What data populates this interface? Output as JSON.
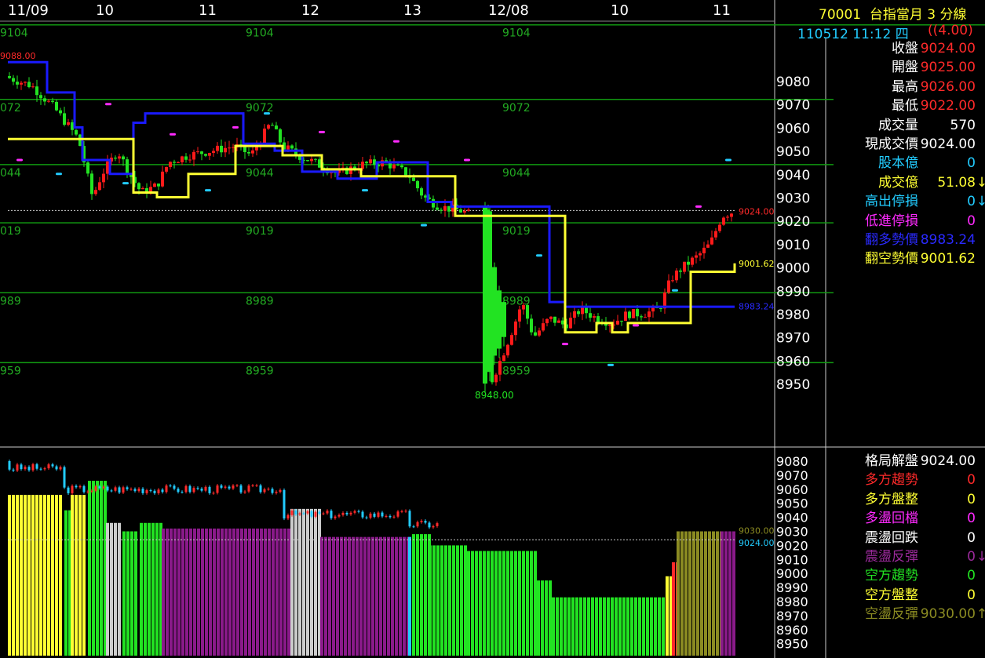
{
  "header": {
    "symbol": "70001",
    "title": "台指當月 3 分線",
    "datetime": "110512 11:12 四",
    "change": "((4.00)"
  },
  "colors": {
    "up": "#ff1a1a",
    "down": "#22e322",
    "break_line": "#ffff33",
    "trend_line": "#1a1aff",
    "grid": "#119911",
    "axis_text": "#ffffff"
  },
  "main_chart": {
    "time_labels": [
      "11/09",
      "10",
      "11",
      "12",
      "13",
      "12/08",
      "10",
      "11"
    ],
    "y_ticks": [
      9080,
      9070,
      9060,
      9050,
      9040,
      9030,
      9020,
      9010,
      9000,
      8990,
      8980,
      8970,
      8960,
      8950
    ],
    "green_levels": [
      {
        "value": 9104,
        "labels": [
          "9104",
          "9104",
          "9104"
        ]
      },
      {
        "value": 9072,
        "labels": [
          "072",
          "9072",
          "9072"
        ]
      },
      {
        "value": 9044,
        "labels": [
          "044",
          "9044",
          "9044"
        ]
      },
      {
        "value": 9019,
        "labels": [
          "019",
          "9019",
          "9019"
        ]
      },
      {
        "value": 8989,
        "labels": [
          "989",
          "8989",
          "8989"
        ]
      },
      {
        "value": 8959,
        "labels": [
          "959",
          "8959",
          "8959"
        ]
      }
    ],
    "annotations": {
      "high_marker": "9088.00",
      "low_marker": "8948.00",
      "last_price": "9024.00",
      "break_line_value": "9001.62",
      "trend_line_value": "8983.24"
    }
  },
  "chart_data": [
    {
      "type": "candlestick",
      "series": [
        {
          "name": "翻多勢價",
          "values": [
            9088,
            9075,
            9060,
            9046,
            9040,
            9040,
            9062,
            9066,
            9053,
            9050,
            9041,
            9038,
            9045,
            9045,
            9028,
            9026,
            9026,
            9026,
            8985,
            8983,
            8983,
            8983,
            8983,
            8983,
            8983,
            8983
          ]
        },
        {
          "name": "翻空勢價",
          "values": [
            9055,
            9055,
            9055,
            9055,
            9032,
            9030,
            9040,
            9052,
            9048,
            9042,
            9039,
            9039,
            9039,
            9039,
            9022,
            9022,
            9022,
            9022,
            8972,
            8972,
            8976,
            8972,
            8976,
            8976,
            8998,
            9001.62
          ]
        }
      ],
      "price_range": [
        8945,
        9112
      ],
      "last_close": 9024.0
    },
    {
      "type": "bar",
      "title": "",
      "series": [
        {
          "name": "state",
          "values": [
            9080,
            9060,
            9040,
            9020,
            9000,
            8980,
            8960
          ]
        }
      ]
    }
  ],
  "quote_panel": {
    "rows": [
      {
        "label": "收盤",
        "value": "9024.00",
        "label_color": "#ffffff",
        "value_color": "#ff2a2a"
      },
      {
        "label": "開盤",
        "value": "9025.00",
        "label_color": "#ffffff",
        "value_color": "#ff2a2a"
      },
      {
        "label": "最高",
        "value": "9026.00",
        "label_color": "#ffffff",
        "value_color": "#ff2a2a"
      },
      {
        "label": "最低",
        "value": "9022.00",
        "label_color": "#ffffff",
        "value_color": "#ff2a2a"
      },
      {
        "label": "成交量",
        "value": "570",
        "label_color": "#ffffff",
        "value_color": "#ffffff"
      },
      {
        "label": "現成交價",
        "value": "9024.00",
        "label_color": "#ffffff",
        "value_color": "#ffffff"
      },
      {
        "label": "股本億",
        "value": "0",
        "label_color": "#22ccff",
        "value_color": "#22ccff"
      },
      {
        "label": "成交億",
        "value": "51.08",
        "label_color": "#ffff33",
        "value_color": "#ffff33",
        "arrow": "↓",
        "arrow_color": "#ffff33"
      },
      {
        "label": "高出停損",
        "value": "0",
        "label_color": "#22ccff",
        "value_color": "#22ccff",
        "arrow": "↓",
        "arrow_color": "#22ccff"
      },
      {
        "label": "低進停損",
        "value": "0",
        "label_color": "#ff2aff",
        "value_color": "#ff2aff"
      },
      {
        "label": "翻多勢價",
        "value": "8983.24",
        "label_color": "#2a2aff",
        "value_color": "#2a2aff"
      },
      {
        "label": "翻空勢價",
        "value": "9001.62",
        "label_color": "#ffff33",
        "value_color": "#ffff33"
      }
    ]
  },
  "state_panel": {
    "rows": [
      {
        "label": "格局解盤",
        "value": "9024.00",
        "label_color": "#ffffff",
        "value_color": "#ffffff"
      },
      {
        "label": "多方趨勢",
        "value": "0",
        "label_color": "#ff2a2a",
        "value_color": "#ff2a2a"
      },
      {
        "label": "多方盤整",
        "value": "0",
        "label_color": "#ffff33",
        "value_color": "#ffff33"
      },
      {
        "label": "多盪回檔",
        "value": "0",
        "label_color": "#ff2aff",
        "value_color": "#ff2aff"
      },
      {
        "label": "震盪回跌",
        "value": "0",
        "label_color": "#ffffff",
        "value_color": "#ffffff"
      },
      {
        "label": "震盪反彈",
        "value": "0",
        "label_color": "#9a2a9a",
        "value_color": "#9a2a9a",
        "arrow": "↓",
        "arrow_color": "#9a2a9a"
      },
      {
        "label": "空方趨勢",
        "value": "0",
        "label_color": "#22e322",
        "value_color": "#22e322"
      },
      {
        "label": "空方盤整",
        "value": "0",
        "label_color": "#ffff33",
        "value_color": "#ffff33"
      },
      {
        "label": "空盪反彈",
        "value": "9030.00",
        "label_color": "#8b8b22",
        "value_color": "#8b8b22",
        "arrow": "↑",
        "arrow_color": "#8b8b22"
      }
    ]
  },
  "sub_chart": {
    "y_ticks": [
      9080,
      9070,
      9060,
      9050,
      9040,
      9030,
      9020,
      9010,
      9000,
      8990,
      8980,
      8970,
      8960,
      8950
    ],
    "labels": {
      "upper": "9030.00",
      "lower": "9024.00"
    }
  }
}
